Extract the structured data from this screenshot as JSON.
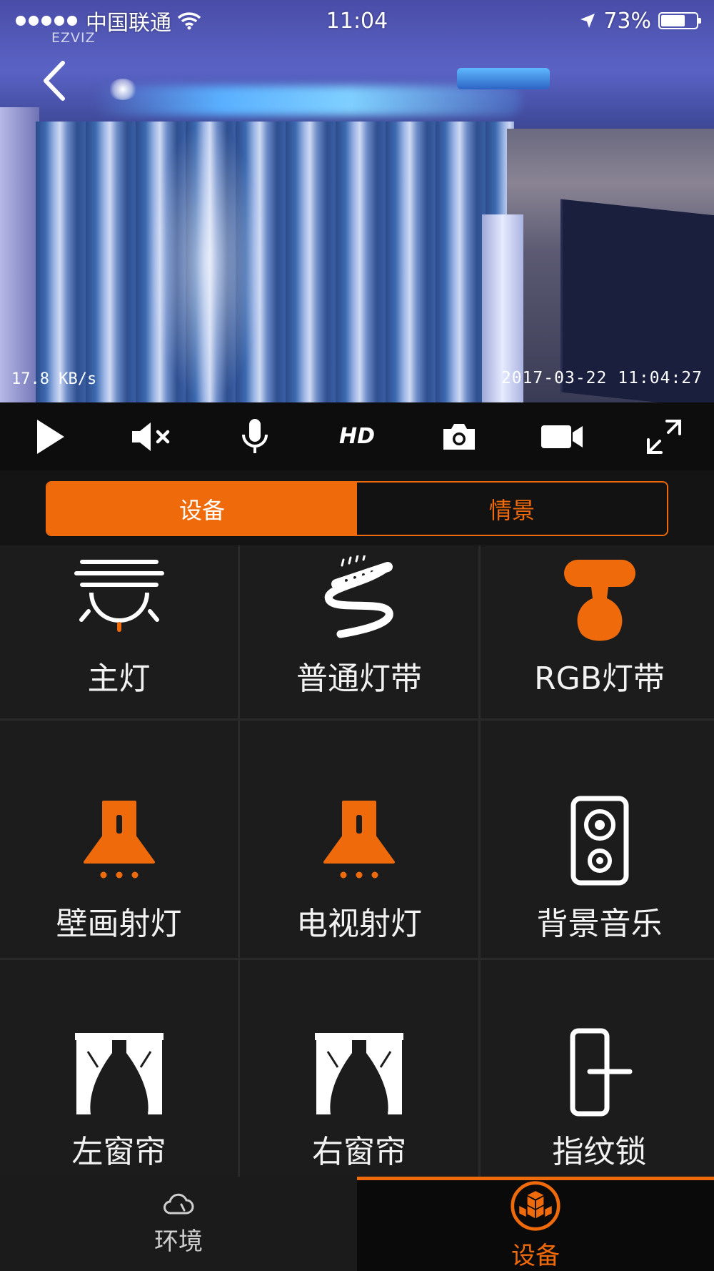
{
  "status_bar": {
    "carrier": "中国联通",
    "time": "11:04",
    "battery": "73%",
    "battery_level": 0.73
  },
  "video": {
    "brand": "EZVIZ",
    "bitrate": "17.8 KB/s",
    "timestamp": "2017-03-22 11:04:27"
  },
  "controls": {
    "hd_label": "HD",
    "icons": [
      "play-icon",
      "mute-icon",
      "microphone-icon",
      "hd-icon",
      "camera-icon",
      "video-camera-icon",
      "fullscreen-icon"
    ]
  },
  "segment": {
    "tabs": [
      "设备",
      "情景"
    ],
    "selected": "设备"
  },
  "devices": [
    {
      "label": "主灯",
      "icon": "ceiling-light-icon"
    },
    {
      "label": "普通灯带",
      "icon": "light-strip-icon"
    },
    {
      "label": "RGB灯带",
      "icon": "rgb-strip-icon"
    },
    {
      "label": "壁画射灯",
      "icon": "spotlight-icon"
    },
    {
      "label": "电视射灯",
      "icon": "spotlight-icon"
    },
    {
      "label": "背景音乐",
      "icon": "speaker-icon"
    },
    {
      "label": "左窗帘",
      "icon": "curtain-icon"
    },
    {
      "label": "右窗帘",
      "icon": "curtain-icon"
    },
    {
      "label": "指纹锁",
      "icon": "door-lock-icon"
    }
  ],
  "tabbar": {
    "tabs": [
      {
        "label": "环境",
        "icon": "cloud-icon"
      },
      {
        "label": "设备",
        "icon": "cubes-icon"
      }
    ],
    "selected": "设备"
  },
  "colors": {
    "accent": "#ef6a0b",
    "background": "#141414",
    "tile": "#1c1c1c"
  }
}
